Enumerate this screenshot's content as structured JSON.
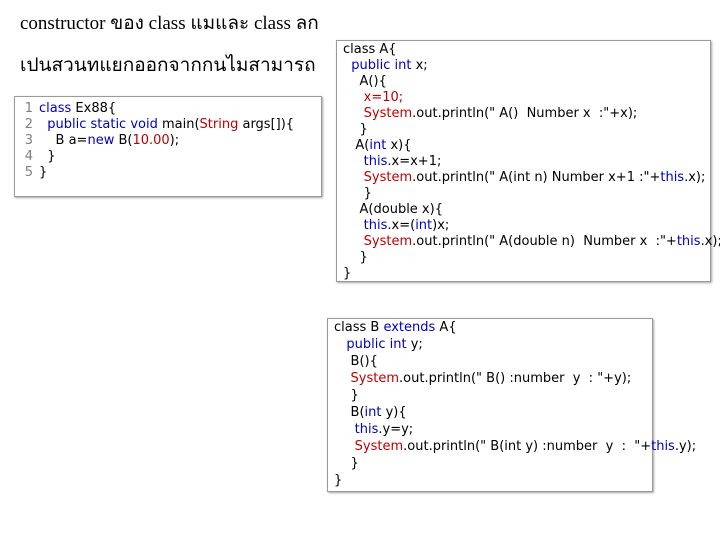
{
  "title": {
    "line1": "constructor ของ class แมและ   class ลก",
    "line2": "เปนสวนทแยกออกจากกนไมสามารถ"
  },
  "main_code": {
    "line_numbers": [
      "1",
      "2",
      "3",
      "4",
      "5"
    ],
    "lines": [
      [
        {
          "t": "class ",
          "c": "kw"
        },
        {
          "t": "Ex88{",
          "c": ""
        }
      ],
      [
        {
          "t": "  public static void ",
          "c": "kw"
        },
        {
          "t": "main(",
          "c": ""
        },
        {
          "t": "String",
          "c": "lit"
        },
        {
          "t": " args[]){",
          "c": ""
        }
      ],
      [
        {
          "t": "    B a=",
          "c": ""
        },
        {
          "t": "new",
          "c": "kw"
        },
        {
          "t": " B(",
          "c": ""
        },
        {
          "t": "10.00",
          "c": "lit"
        },
        {
          "t": ");",
          "c": ""
        }
      ],
      [
        {
          "t": "  }",
          "c": ""
        }
      ],
      [
        {
          "t": "}",
          "c": ""
        }
      ]
    ]
  },
  "class_a": {
    "lines": [
      [
        {
          "t": "class A{",
          "c": ""
        }
      ],
      [
        {
          "t": "  public int ",
          "c": "kw"
        },
        {
          "t": "x;",
          "c": ""
        }
      ],
      [
        {
          "t": "    A(){",
          "c": ""
        }
      ],
      [
        {
          "t": "     x=10;",
          "c": "lit"
        }
      ],
      [
        {
          "t": "     System",
          "c": "lit"
        },
        {
          "t": ".out.println(\" A()  Number x  :\"+x);",
          "c": ""
        }
      ],
      [
        {
          "t": "    }",
          "c": ""
        }
      ],
      [
        {
          "t": "   A(",
          "c": ""
        },
        {
          "t": "int",
          "c": "kw"
        },
        {
          "t": " x){",
          "c": ""
        }
      ],
      [
        {
          "t": "     this",
          "c": "kw"
        },
        {
          "t": ".x=x+1;",
          "c": ""
        }
      ],
      [
        {
          "t": "     System",
          "c": "lit"
        },
        {
          "t": ".out.println(\" A(int n) Number x+1 :\"+",
          "c": ""
        },
        {
          "t": "this",
          "c": "kw"
        },
        {
          "t": ".x);",
          "c": ""
        }
      ],
      [
        {
          "t": "     }",
          "c": ""
        }
      ],
      [
        {
          "t": "    A(double x){",
          "c": ""
        }
      ],
      [
        {
          "t": "     this",
          "c": "kw"
        },
        {
          "t": ".x=(",
          "c": ""
        },
        {
          "t": "int",
          "c": "kw"
        },
        {
          "t": ")x;",
          "c": ""
        }
      ],
      [
        {
          "t": "     System",
          "c": "lit"
        },
        {
          "t": ".out.println(\" A(double n)  Number x  :\"+",
          "c": ""
        },
        {
          "t": "this",
          "c": "kw"
        },
        {
          "t": ".x);",
          "c": ""
        }
      ],
      [
        {
          "t": "    }",
          "c": ""
        }
      ],
      [
        {
          "t": "}",
          "c": ""
        }
      ]
    ]
  },
  "class_b": {
    "lines": [
      [
        {
          "t": "class B ",
          "c": ""
        },
        {
          "t": "extends",
          "c": "kw"
        },
        {
          "t": " A{",
          "c": ""
        }
      ],
      [
        {
          "t": "   public int ",
          "c": "kw"
        },
        {
          "t": "y;",
          "c": ""
        }
      ],
      [
        {
          "t": "    B(){",
          "c": ""
        }
      ],
      [
        {
          "t": "    System",
          "c": "lit"
        },
        {
          "t": ".out.println(\" B() :number  y  : \"+y);",
          "c": ""
        }
      ],
      [
        {
          "t": "    }",
          "c": ""
        }
      ],
      [
        {
          "t": "    B(",
          "c": ""
        },
        {
          "t": "int",
          "c": "kw"
        },
        {
          "t": " y){",
          "c": ""
        }
      ],
      [
        {
          "t": "     this",
          "c": "kw"
        },
        {
          "t": ".y=y;",
          "c": ""
        }
      ],
      [
        {
          "t": "     System",
          "c": "lit"
        },
        {
          "t": ".out.println(\" B(int y) :number  y  :  \"+",
          "c": ""
        },
        {
          "t": "this",
          "c": "kw"
        },
        {
          "t": ".y);",
          "c": ""
        }
      ],
      [
        {
          "t": "    }",
          "c": ""
        }
      ],
      [
        {
          "t": "}",
          "c": ""
        }
      ]
    ]
  }
}
